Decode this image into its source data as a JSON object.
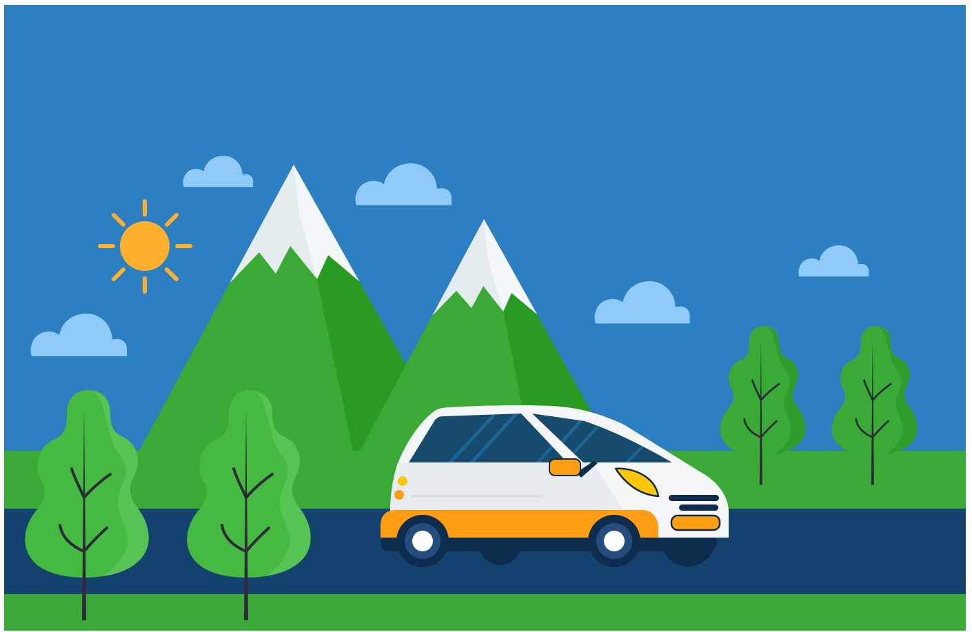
{
  "colors": {
    "page_background": "#FFFFFF",
    "sky": "#2C7FC1",
    "cloud": "#90CAF9",
    "sun": "#FFB02E",
    "mountain": "#3BA935",
    "mountain_shade": "#279B22",
    "snow": "#E4ECF0",
    "snow_highlight": "#F2F7FA",
    "grass": "#3AA935",
    "road": "#14426F",
    "front_tree": "#45BA41",
    "front_tree_light": "#55C452",
    "back_tree": "#3AAA37",
    "back_tree_dark": "#2F9D2C",
    "trunk": "#2D2A3A",
    "car_body": "#F4F6F7",
    "car_side": "#E6ECEF",
    "car_trim": "#D6E0E6",
    "car_accent": "#FF9E12",
    "car_window": "#164B6E",
    "car_window_glare": "#1E6597",
    "car_dark": "#0E2C4D",
    "wheel_ring": "#244D7D",
    "hubcap": "#FFFFFF",
    "headlight": "#FFC60A"
  }
}
